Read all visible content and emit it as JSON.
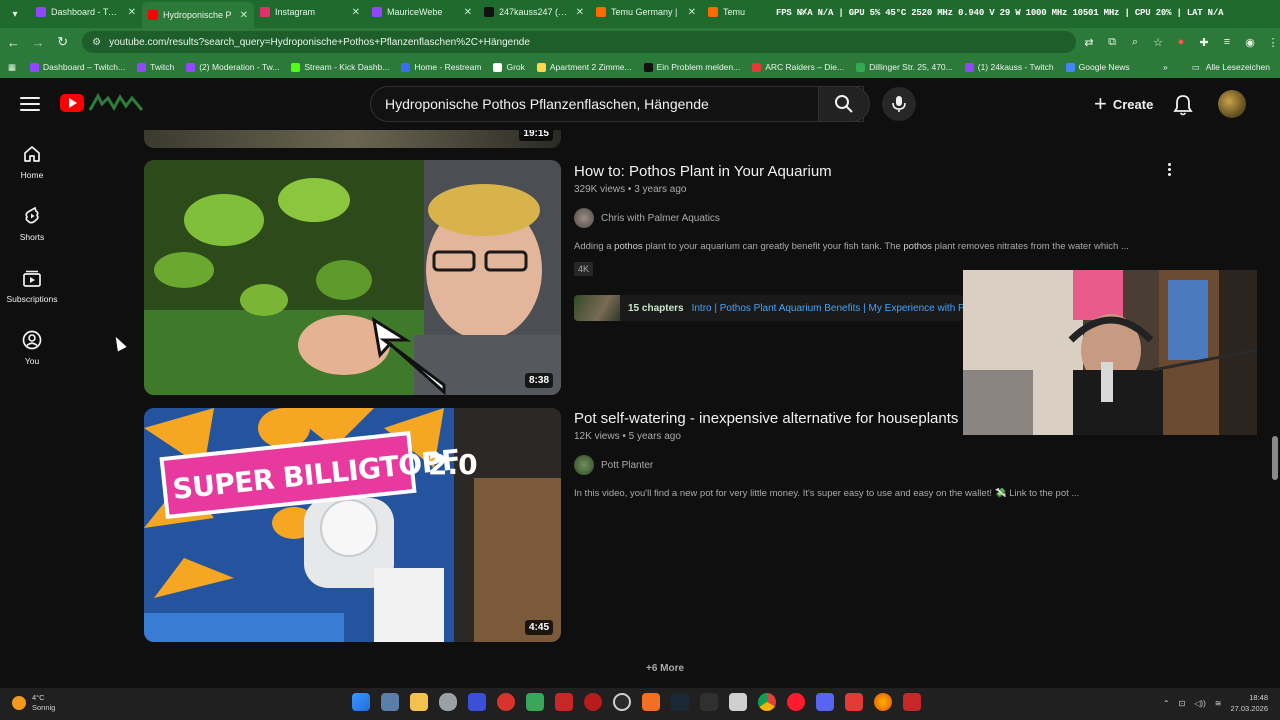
{
  "browser": {
    "tabs": [
      {
        "label": "Dashboard - Twitc",
        "color": "#9146ff",
        "active": false
      },
      {
        "label": "Hydroponische P",
        "color": "#ff0000",
        "active": true
      },
      {
        "label": "Instagram",
        "color": "#e1306c",
        "active": false
      },
      {
        "label": "MauriceWebe",
        "color": "#9146ff",
        "active": false
      },
      {
        "label": "247kauss247 (@2",
        "color": "#111111",
        "active": false
      },
      {
        "label": "Temu Germany |",
        "color": "#ff6a00",
        "active": false
      },
      {
        "label": "Temu",
        "color": "#ff6a00",
        "active": false
      }
    ],
    "overlay_stats": "FPS N/A N/A | GPU 5% 45°C 2520 MHz 0.940 V 29 W 1000 MHz 10501 MHz | CPU 20% | LAT N/A",
    "url": "youtube.com/results?search_query=Hydroponische+Pothos+Pflanzenflaschen%2C+Hängende",
    "bookmarks": [
      {
        "label": "Dashboard – Twitch...",
        "color": "#9146ff"
      },
      {
        "label": "Twitch",
        "color": "#9146ff"
      },
      {
        "label": "(2) Moderation - Tw...",
        "color": "#9146ff"
      },
      {
        "label": "Stream - Kick Dashb...",
        "color": "#53fc18"
      },
      {
        "label": "Home - Restream",
        "color": "#3b6cf6"
      },
      {
        "label": "Grok",
        "color": "#ffffff"
      },
      {
        "label": "Apartment 2 Zimme...",
        "color": "#ffd84d"
      },
      {
        "label": "Ein Problem melden...",
        "color": "#111111"
      },
      {
        "label": "ARC Raiders – Die...",
        "color": "#e53935"
      },
      {
        "label": "Dillinger Str. 25, 470...",
        "color": "#34a853"
      },
      {
        "label": "(1) 24kauss - Twitch",
        "color": "#9146ff"
      },
      {
        "label": "Google News",
        "color": "#4285f4"
      }
    ],
    "bookmarks_folder": "Alle Lesezeichen"
  },
  "youtube": {
    "search_query": "Hydroponische Pothos Pflanzenflaschen, Hängende",
    "create_label": "Create",
    "sidebar": [
      {
        "label": "Home"
      },
      {
        "label": "Shorts"
      },
      {
        "label": "Subscriptions"
      },
      {
        "label": "You"
      }
    ],
    "prev_result_duration": "19:15",
    "videos": [
      {
        "title": "How to: Pothos Plant in Your Aquarium",
        "views": "329K views",
        "age": "3 years ago",
        "channel": "Chris with Palmer Aquatics",
        "desc_pre": "Adding a ",
        "desc_b1": "pothos",
        "desc_mid": " plant to your aquarium can greatly benefit your fish tank. The ",
        "desc_b2": "pothos",
        "desc_post": " plant removes nitrates from the water which ...",
        "badge": "4K",
        "chapters_count": "15 chapters",
        "chapters_list": "Intro | Pothos Plant Aquarium Benefits | My Experience with P",
        "duration": "8:38"
      },
      {
        "title": "Pot self-watering - inexpensive alternative for houseplants",
        "views": "12K views",
        "age": "5 years ago",
        "channel": "Pott Planter",
        "desc": "In this video, you'll find a new pot for very little money. It's super easy to use and easy on the wallet! 💸 Link to the pot ...",
        "thumb_text_1": "SUPER BILLIGTOPF",
        "thumb_text_2": "2.0",
        "duration": "4:45"
      }
    ],
    "more_label": "+6 More"
  },
  "taskbar": {
    "temp": "4°C",
    "weather": "Sonnig",
    "time": "18:48",
    "date": "27.03.2026"
  }
}
